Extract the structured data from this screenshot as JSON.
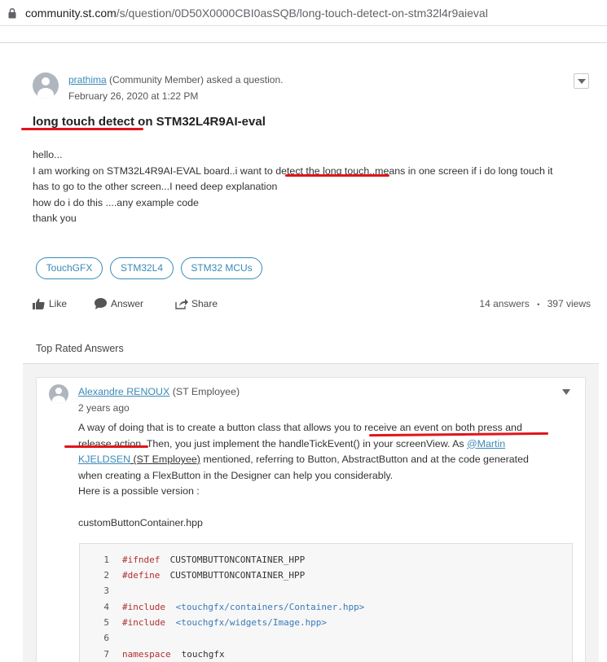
{
  "browser": {
    "url_host": "community.st.com",
    "url_path": "/s/question/0D50X0000CBI0asSQB/long-touch-detect-on-stm32l4r9aieval"
  },
  "question": {
    "author": "prathima",
    "author_role": "(Community Member) asked a question.",
    "date": "February 26, 2020 at 1:22 PM",
    "title_part1": "long touch detect",
    "title_part2": " on STM32L4R9AI-eval",
    "body": {
      "line1": "hello...",
      "line2_a": "I am working on STM32L4R9AI-EVAL board..i want to ",
      "line2_b": "detect the long touch",
      "line2_c": "..means in one screen if i do long touch it",
      "line3": "has to go to the other screen...I need deep explanation",
      "line4": "how do i do this ....any example code",
      "line5": "thank you"
    },
    "tags": [
      "TouchGFX",
      "STM32L4",
      "STM32 MCUs"
    ],
    "actions": {
      "like": "Like",
      "answer": "Answer",
      "share": "Share"
    },
    "stats": {
      "answers": "14 answers",
      "separator": "•",
      "views": "397 views"
    }
  },
  "top_rated_label": "Top Rated Answers",
  "answer": {
    "author": "Alexandre RENOUX",
    "author_role": " (ST Employee)",
    "date": "2 years ago",
    "line1_a": "A way of doing that is to create a button class that allows you to ",
    "line1_b": "receive an event on both press and",
    "line2_a": "release action",
    "line2_b": ". Then, you just implement the handleTickEvent() in your screenView. As ",
    "line2_mention": "@Martin",
    "line3_mention": "KJELDSEN",
    "line3_b": " (ST Employee)",
    "line3_c": " mentioned, referring to Button, AbstractButton and at the code generated",
    "line4": "when creating a FlexButton in the Designer can help you considerably.",
    "line5": "Here is a possible version :",
    "filename": "customButtonContainer.hpp",
    "code_lines": [
      {
        "n": "1",
        "kw": "#ifndef",
        "rest": " CUSTOMBUTTONCONTAINER_HPP"
      },
      {
        "n": "2",
        "kw": "#define",
        "rest": " CUSTOMBUTTONCONTAINER_HPP"
      },
      {
        "n": "3",
        "kw": "",
        "rest": ""
      },
      {
        "n": "4",
        "kw": "#include",
        "rest": " <touchgfx/containers/Container.hpp>"
      },
      {
        "n": "5",
        "kw": "#include",
        "rest": " <touchgfx/widgets/Image.hpp>"
      },
      {
        "n": "6",
        "kw": "",
        "rest": ""
      },
      {
        "n": "7",
        "kw": "namespace",
        "rest": " touchgfx"
      }
    ]
  },
  "colors": {
    "link": "#3a8ab8",
    "annotation_red": "#e2141b",
    "code_keyword": "#b03030"
  }
}
